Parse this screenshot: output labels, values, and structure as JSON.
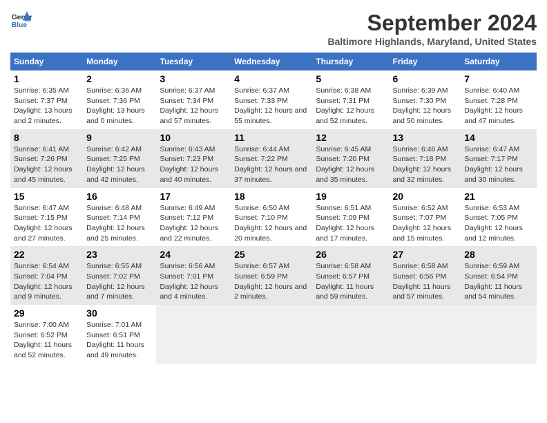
{
  "header": {
    "logo_line1": "General",
    "logo_line2": "Blue",
    "title": "September 2024",
    "subtitle": "Baltimore Highlands, Maryland, United States"
  },
  "days_of_week": [
    "Sunday",
    "Monday",
    "Tuesday",
    "Wednesday",
    "Thursday",
    "Friday",
    "Saturday"
  ],
  "weeks": [
    [
      {
        "day": "1",
        "sunrise": "6:35 AM",
        "sunset": "7:37 PM",
        "daylight": "13 hours and 2 minutes"
      },
      {
        "day": "2",
        "sunrise": "6:36 AM",
        "sunset": "7:36 PM",
        "daylight": "13 hours and 0 minutes"
      },
      {
        "day": "3",
        "sunrise": "6:37 AM",
        "sunset": "7:34 PM",
        "daylight": "12 hours and 57 minutes"
      },
      {
        "day": "4",
        "sunrise": "6:37 AM",
        "sunset": "7:33 PM",
        "daylight": "12 hours and 55 minutes"
      },
      {
        "day": "5",
        "sunrise": "6:38 AM",
        "sunset": "7:31 PM",
        "daylight": "12 hours and 52 minutes"
      },
      {
        "day": "6",
        "sunrise": "6:39 AM",
        "sunset": "7:30 PM",
        "daylight": "12 hours and 50 minutes"
      },
      {
        "day": "7",
        "sunrise": "6:40 AM",
        "sunset": "7:28 PM",
        "daylight": "12 hours and 47 minutes"
      }
    ],
    [
      {
        "day": "8",
        "sunrise": "6:41 AM",
        "sunset": "7:26 PM",
        "daylight": "12 hours and 45 minutes"
      },
      {
        "day": "9",
        "sunrise": "6:42 AM",
        "sunset": "7:25 PM",
        "daylight": "12 hours and 42 minutes"
      },
      {
        "day": "10",
        "sunrise": "6:43 AM",
        "sunset": "7:23 PM",
        "daylight": "12 hours and 40 minutes"
      },
      {
        "day": "11",
        "sunrise": "6:44 AM",
        "sunset": "7:22 PM",
        "daylight": "12 hours and 37 minutes"
      },
      {
        "day": "12",
        "sunrise": "6:45 AM",
        "sunset": "7:20 PM",
        "daylight": "12 hours and 35 minutes"
      },
      {
        "day": "13",
        "sunrise": "6:46 AM",
        "sunset": "7:18 PM",
        "daylight": "12 hours and 32 minutes"
      },
      {
        "day": "14",
        "sunrise": "6:47 AM",
        "sunset": "7:17 PM",
        "daylight": "12 hours and 30 minutes"
      }
    ],
    [
      {
        "day": "15",
        "sunrise": "6:47 AM",
        "sunset": "7:15 PM",
        "daylight": "12 hours and 27 minutes"
      },
      {
        "day": "16",
        "sunrise": "6:48 AM",
        "sunset": "7:14 PM",
        "daylight": "12 hours and 25 minutes"
      },
      {
        "day": "17",
        "sunrise": "6:49 AM",
        "sunset": "7:12 PM",
        "daylight": "12 hours and 22 minutes"
      },
      {
        "day": "18",
        "sunrise": "6:50 AM",
        "sunset": "7:10 PM",
        "daylight": "12 hours and 20 minutes"
      },
      {
        "day": "19",
        "sunrise": "6:51 AM",
        "sunset": "7:09 PM",
        "daylight": "12 hours and 17 minutes"
      },
      {
        "day": "20",
        "sunrise": "6:52 AM",
        "sunset": "7:07 PM",
        "daylight": "12 hours and 15 minutes"
      },
      {
        "day": "21",
        "sunrise": "6:53 AM",
        "sunset": "7:05 PM",
        "daylight": "12 hours and 12 minutes"
      }
    ],
    [
      {
        "day": "22",
        "sunrise": "6:54 AM",
        "sunset": "7:04 PM",
        "daylight": "12 hours and 9 minutes"
      },
      {
        "day": "23",
        "sunrise": "6:55 AM",
        "sunset": "7:02 PM",
        "daylight": "12 hours and 7 minutes"
      },
      {
        "day": "24",
        "sunrise": "6:56 AM",
        "sunset": "7:01 PM",
        "daylight": "12 hours and 4 minutes"
      },
      {
        "day": "25",
        "sunrise": "6:57 AM",
        "sunset": "6:59 PM",
        "daylight": "12 hours and 2 minutes"
      },
      {
        "day": "26",
        "sunrise": "6:58 AM",
        "sunset": "6:57 PM",
        "daylight": "11 hours and 59 minutes"
      },
      {
        "day": "27",
        "sunrise": "6:58 AM",
        "sunset": "6:56 PM",
        "daylight": "11 hours and 57 minutes"
      },
      {
        "day": "28",
        "sunrise": "6:59 AM",
        "sunset": "6:54 PM",
        "daylight": "11 hours and 54 minutes"
      }
    ],
    [
      {
        "day": "29",
        "sunrise": "7:00 AM",
        "sunset": "6:52 PM",
        "daylight": "11 hours and 52 minutes"
      },
      {
        "day": "30",
        "sunrise": "7:01 AM",
        "sunset": "6:51 PM",
        "daylight": "11 hours and 49 minutes"
      },
      null,
      null,
      null,
      null,
      null
    ]
  ]
}
